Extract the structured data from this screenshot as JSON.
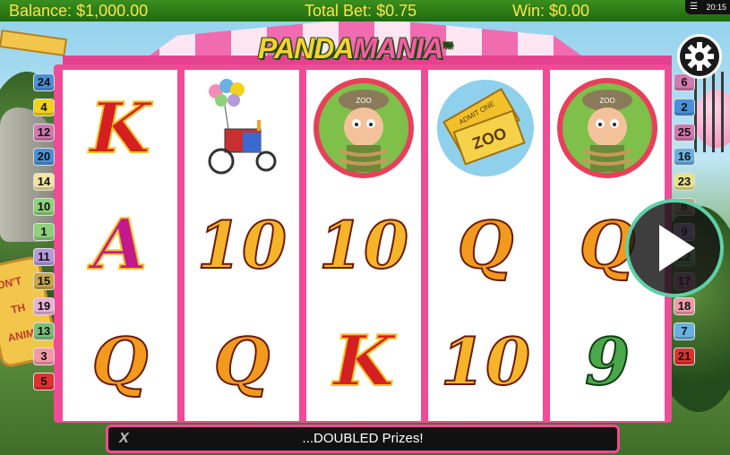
{
  "topbar": {
    "balance_label": "Balance:",
    "balance_value": "$1,000.00",
    "bet_label": "Total Bet:",
    "bet_value": "$0.75",
    "win_label": "Win:",
    "win_value": "$0.00",
    "menu_icon": "menu-icon",
    "clock": "20:15"
  },
  "logo": {
    "part1": "PANDA",
    "part2": "MANIA",
    "tm": "TM"
  },
  "background_sign": {
    "line1": "ON'T",
    "line2": "TH",
    "line3": "ANIM"
  },
  "reels": [
    [
      {
        "type": "letter",
        "value": "K"
      },
      {
        "type": "letter",
        "value": "A"
      },
      {
        "type": "letter",
        "value": "Q"
      }
    ],
    [
      {
        "type": "image",
        "value": "balloon-cart"
      },
      {
        "type": "letter",
        "value": "10"
      },
      {
        "type": "letter",
        "value": "Q"
      }
    ],
    [
      {
        "type": "image",
        "value": "zookeeper",
        "cap": "ZOO"
      },
      {
        "type": "letter",
        "value": "10"
      },
      {
        "type": "letter",
        "value": "K"
      }
    ],
    [
      {
        "type": "image",
        "value": "zoo-tickets",
        "ticket_text": "ZOO",
        "ticket_small": "ADMIT ONE"
      },
      {
        "type": "letter",
        "value": "Q"
      },
      {
        "type": "letter",
        "value": "10"
      }
    ],
    [
      {
        "type": "image",
        "value": "zookeeper",
        "cap": "ZOO"
      },
      {
        "type": "letter",
        "value": "Q"
      },
      {
        "type": "letter",
        "value": "9"
      }
    ]
  ],
  "paylines_left": [
    {
      "n": "24",
      "color": "#4a90d9"
    },
    {
      "n": "4",
      "color": "#f2d21a"
    },
    {
      "n": "12",
      "color": "#d07ab0"
    },
    {
      "n": "20",
      "color": "#4a90d9"
    },
    {
      "n": "14",
      "color": "#f2e6a0"
    },
    {
      "n": "10",
      "color": "#8fd07a"
    },
    {
      "n": "1",
      "color": "#8fd07a"
    },
    {
      "n": "11",
      "color": "#b59adb"
    },
    {
      "n": "15",
      "color": "#c8a64a"
    },
    {
      "n": "19",
      "color": "#e8b3d6"
    },
    {
      "n": "13",
      "color": "#7ac07a"
    },
    {
      "n": "3",
      "color": "#f29aa8"
    },
    {
      "n": "5",
      "color": "#e03030"
    }
  ],
  "paylines_right": [
    {
      "n": "6",
      "color": "#d07ab0"
    },
    {
      "n": "2",
      "color": "#4a90d9"
    },
    {
      "n": "25",
      "color": "#d07ab0"
    },
    {
      "n": "16",
      "color": "#6ab0e0"
    },
    {
      "n": "23",
      "color": "#e8e28a"
    },
    {
      "n": "8",
      "color": "#b7a77a"
    },
    {
      "n": "9",
      "color": "#b59adb"
    },
    {
      "n": "22",
      "color": "#7ac07a"
    },
    {
      "n": "17",
      "color": "#d07ab0"
    },
    {
      "n": "18",
      "color": "#f29aa8"
    },
    {
      "n": "7",
      "color": "#6ab0e0"
    },
    {
      "n": "21",
      "color": "#e03030"
    }
  ],
  "buttons": {
    "settings_icon": "gear-icon",
    "spin_icon": "play-icon"
  },
  "message": {
    "x_mark": "X",
    "text": "...DOUBLED Prizes!"
  },
  "colors": {
    "frame": "#f04b96",
    "topbar": "#2a7d16",
    "topbar_text": "#ffe44a",
    "spin_ring": "#5fd0a8"
  }
}
